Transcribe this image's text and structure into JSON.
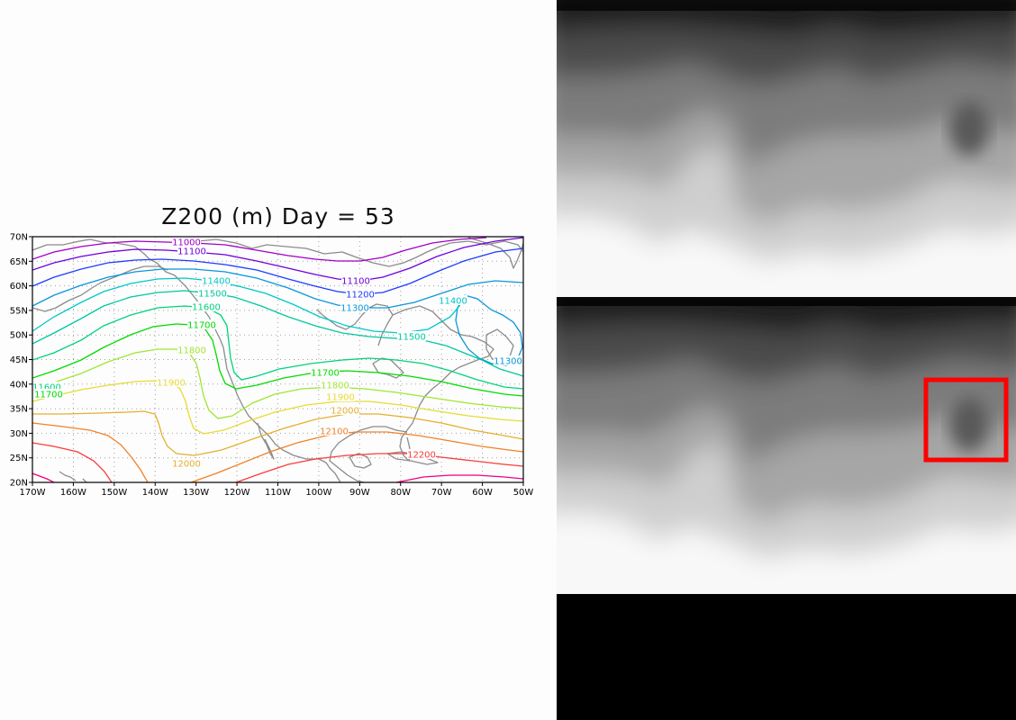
{
  "figure": {
    "title": "Z200 (m) Day = 53"
  },
  "map": {
    "x_ticks": [
      "170W",
      "160W",
      "150W",
      "140W",
      "130W",
      "120W",
      "110W",
      "100W",
      "90W",
      "80W",
      "70W",
      "60W",
      "50W"
    ],
    "y_ticks": [
      "70N",
      "65N",
      "60N",
      "55N",
      "50N",
      "45N",
      "40N",
      "35N",
      "30N",
      "25N",
      "20N"
    ],
    "contours": [
      {
        "level": 11000,
        "label": "11000",
        "color": "#a000c8",
        "label_positions": [
          [
            207,
            269
          ]
        ]
      },
      {
        "level": 11100,
        "label": "11100",
        "color": "#6e00dc",
        "label_positions": [
          [
            213,
            279
          ],
          [
            395,
            312
          ]
        ]
      },
      {
        "level": 11200,
        "label": "11200",
        "color": "#1e3cff",
        "label_positions": [
          [
            400,
            327
          ]
        ]
      },
      {
        "level": 11300,
        "label": "11300",
        "color": "#0a96dc",
        "label_positions": [
          [
            394,
            342
          ],
          [
            564,
            401
          ]
        ]
      },
      {
        "level": 11400,
        "label": "11400",
        "color": "#00c8c8",
        "label_positions": [
          [
            240,
            312
          ],
          [
            503,
            334
          ]
        ]
      },
      {
        "level": 11500,
        "label": "11500",
        "color": "#00c8a0",
        "label_positions": [
          [
            236,
            326
          ],
          [
            457,
            374
          ]
        ]
      },
      {
        "level": 11600,
        "label": "11600",
        "color": "#00d27d",
        "label_positions": [
          [
            229,
            341
          ],
          [
            52,
            430
          ]
        ]
      },
      {
        "level": 11700,
        "label": "11700",
        "color": "#00dc00",
        "label_positions": [
          [
            224,
            361
          ],
          [
            361,
            414
          ],
          [
            54,
            438
          ]
        ]
      },
      {
        "level": 11800,
        "label": "11800",
        "color": "#a0e632",
        "label_positions": [
          [
            213,
            389
          ],
          [
            372,
            428
          ]
        ]
      },
      {
        "level": 11900,
        "label": "11900",
        "color": "#e6dc32",
        "label_positions": [
          [
            190,
            425
          ],
          [
            378,
            441
          ]
        ]
      },
      {
        "level": 12000,
        "label": "12000",
        "color": "#e6af2d",
        "label_positions": [
          [
            383,
            456
          ],
          [
            207,
            515
          ]
        ]
      },
      {
        "level": 12100,
        "label": "12100",
        "color": "#f08228",
        "label_positions": [
          [
            371,
            479
          ]
        ]
      },
      {
        "level": 12200,
        "label": "12200",
        "color": "#fa3c3c",
        "label_positions": [
          [
            468,
            505
          ]
        ]
      },
      {
        "level": 12300,
        "label": "",
        "color": "#f00082",
        "label_positions": []
      }
    ]
  },
  "imagery": {
    "panels": [
      {
        "name": "feature-map-top",
        "colormap": "grayscale"
      },
      {
        "name": "feature-map-bottom",
        "colormap": "grayscale",
        "highlight": {
          "color": "#ff0000"
        }
      }
    ]
  }
}
